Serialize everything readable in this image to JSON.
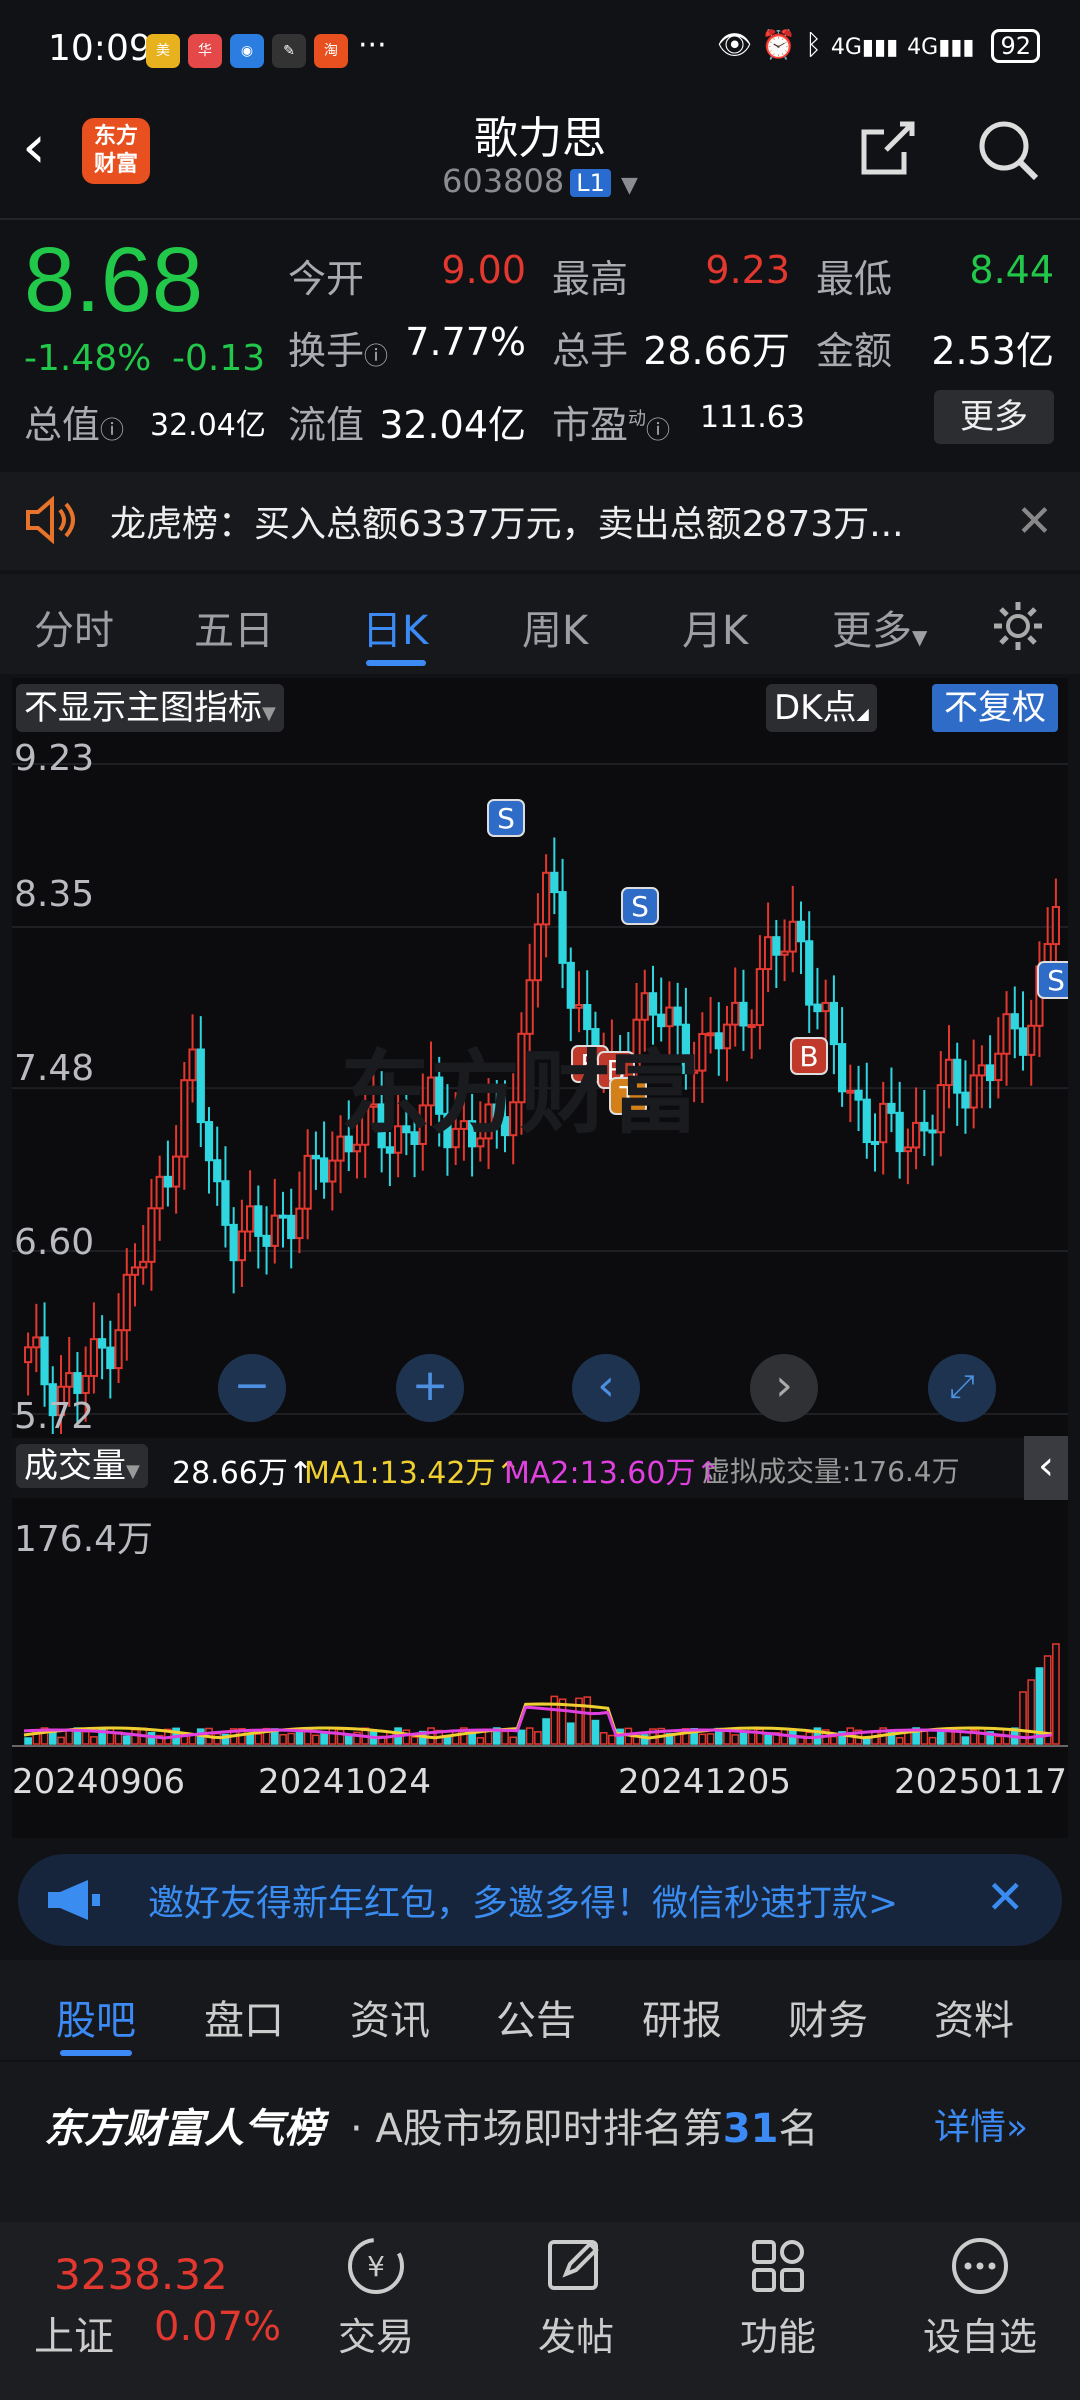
{
  "status": {
    "time": "10:09",
    "right_icons": [
      "eye-icon",
      "alarm-icon",
      "bluetooth-icon",
      "signal-4g-icon",
      "signal-4g-icon"
    ],
    "battery": "92",
    "dots": "···"
  },
  "header": {
    "logo_line1": "东方",
    "logo_line2": "财富",
    "title": "歌力思",
    "code": "603808",
    "level_badge": "L1"
  },
  "quote": {
    "price": "8.68",
    "change_pct": "-1.48%",
    "change_amt": "-0.13",
    "open_label": "今开",
    "open": "9.00",
    "high_label": "最高",
    "high": "9.23",
    "low_label": "最低",
    "low": "8.44",
    "turnover_label": "换手",
    "turnover": "7.77%",
    "volume_label": "总手",
    "volume": "28.66万",
    "amount_label": "金额",
    "amount": "2.53亿",
    "mktcap_label": "总值",
    "mktcap": "32.04亿",
    "float_label": "流值",
    "float": "32.04亿",
    "pe_label": "市盈",
    "pe_sup": "动",
    "pe": "111.63",
    "more_button": "更多"
  },
  "notice": {
    "text": "龙虎榜：买入总额6337万元，卖出总额2873万..."
  },
  "tabs": [
    {
      "label": "分时"
    },
    {
      "label": "五日"
    },
    {
      "label": "日K"
    },
    {
      "label": "周K"
    },
    {
      "label": "月K"
    },
    {
      "label": "更多"
    }
  ],
  "chart": {
    "indicator_selector": "不显示主图指标",
    "dk_button": "DK点",
    "fq_button": "不复权",
    "price_axis": [
      "9.23",
      "8.35",
      "7.48",
      "6.60",
      "5.72"
    ],
    "volume_selector": "成交量",
    "volume_value": "28.66万",
    "ma1": "MA1:13.42万",
    "ma2": "MA2:13.60万",
    "virtual_volume": "虚拟成交量:176.4万",
    "volume_max": "176.4万",
    "dates": [
      "20240906",
      "20241024",
      "20241205",
      "20250117"
    ],
    "marker_s": "S",
    "marker_b": "B",
    "marker_t": "T",
    "watermark": "东方财富"
  },
  "chart_data": {
    "type": "candlestick",
    "y_ticks": [
      9.23,
      8.35,
      7.48,
      6.6,
      5.72
    ],
    "ylim": [
      5.72,
      9.23
    ],
    "x_tick_labels": [
      "20240906",
      "20241024",
      "20241205",
      "20250117"
    ],
    "signals": [
      {
        "label": "S"
      },
      {
        "label": "S"
      },
      {
        "label": "S"
      },
      {
        "label": "B"
      },
      {
        "label": "B"
      },
      {
        "label": "B"
      },
      {
        "label": "T"
      }
    ]
  },
  "banner": {
    "text": "邀好友得新年红包，多邀多得！微信秒速打款>"
  },
  "bottom_tabs": [
    {
      "label": "股吧"
    },
    {
      "label": "盘口"
    },
    {
      "label": "资讯"
    },
    {
      "label": "公告"
    },
    {
      "label": "研报"
    },
    {
      "label": "财务"
    },
    {
      "label": "资料"
    }
  ],
  "rank": {
    "brand": "东方财富人气榜",
    "text_prefix": "· A股市场即时排名第",
    "rank_number": "31",
    "text_suffix": "名",
    "detail_link": "详情"
  },
  "bottom_nav": {
    "index_value": "3238.32",
    "index_name": "上证",
    "index_change": "0.07%",
    "items": [
      {
        "label": "交易",
        "icon": "yuan-exchange-icon"
      },
      {
        "label": "发帖",
        "icon": "edit-icon"
      },
      {
        "label": "功能",
        "icon": "grid-icon"
      },
      {
        "label": "设自选",
        "icon": "more-circle-icon"
      }
    ]
  }
}
